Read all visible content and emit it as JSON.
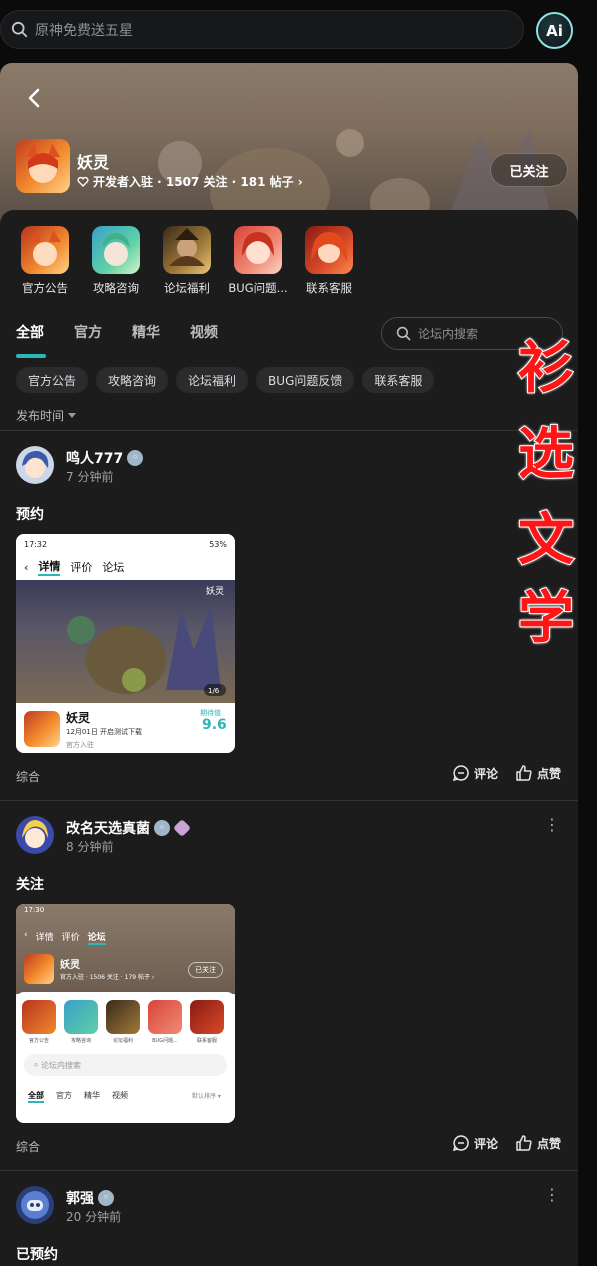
{
  "search": {
    "placeholder": "原神免费送五星"
  },
  "ai_button": {
    "label": "Ai"
  },
  "forum": {
    "name": "妖灵",
    "meta": "开发者入驻 · 1507 关注 · 181 帖子 ›",
    "follow_label": "已关注"
  },
  "shortcuts": [
    {
      "label": "官方公告"
    },
    {
      "label": "攻略咨询"
    },
    {
      "label": "论坛福利"
    },
    {
      "label": "BUG问题..."
    },
    {
      "label": "联系客服"
    }
  ],
  "tabs": [
    {
      "label": "全部"
    },
    {
      "label": "官方"
    },
    {
      "label": "精华"
    },
    {
      "label": "视频"
    }
  ],
  "forum_search": {
    "placeholder": "论坛内搜索"
  },
  "chips": [
    {
      "label": "官方公告"
    },
    {
      "label": "攻略咨询"
    },
    {
      "label": "论坛福利"
    },
    {
      "label": "BUG问题反馈"
    },
    {
      "label": "联系客服"
    }
  ],
  "sort": {
    "label": "发布时间"
  },
  "posts": [
    {
      "user": "鸣人777",
      "time": "7 分钟前",
      "title": "预约",
      "tag": "综合",
      "comment_label": "评论",
      "like_label": "点赞",
      "image": {
        "status_time": "17:32",
        "battery": "53%",
        "nav_tabs": [
          "详情",
          "评价",
          "论坛"
        ],
        "page_indicator": "1/6",
        "game_name": "妖灵",
        "game_date": "12月01日 开启测试下载",
        "official": "官方入驻",
        "score_label": "期待值",
        "score": "9.6",
        "art_title": "妖灵"
      }
    },
    {
      "user": "改名天选真菌",
      "time": "8 分钟前",
      "title": "关注",
      "tag": "综合",
      "comment_label": "评论",
      "like_label": "点赞",
      "image": {
        "status_time": "17:30",
        "nav_tabs": [
          "详情",
          "评价",
          "论坛"
        ],
        "game_name": "妖灵",
        "game_meta": "官方入驻 · 1506 关注 · 179 帖子 ›",
        "follow_label": "已关注",
        "shortcuts": [
          "官方公告",
          "攻略咨询",
          "论坛福利",
          "BUG问题...",
          "联系客服"
        ],
        "search_placeholder": "论坛内搜索",
        "tabs": [
          "全部",
          "官方",
          "精华",
          "视频"
        ],
        "sort_label": "默认排序 ▾"
      }
    },
    {
      "user": "郭强",
      "time": "20 分钟前",
      "title": "已预约"
    }
  ],
  "watermark": [
    "衫",
    "选",
    "文",
    "学"
  ],
  "colors": {
    "accent": "#2db6b8",
    "background": "#1c1c1d",
    "watermark": "#ff1515"
  }
}
